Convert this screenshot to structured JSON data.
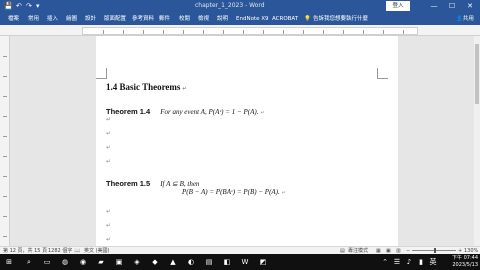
{
  "window": {
    "doc_title": "chapter_1_2023 - Word",
    "sign_in": "登入",
    "controls": [
      "—",
      "☐",
      "✕"
    ]
  },
  "ribbon": {
    "tabs": [
      "檔案",
      "常用",
      "插入",
      "繪圖",
      "設計",
      "版面配置",
      "參考資料",
      "郵件",
      "校閱",
      "檢視",
      "說明",
      "EndNote X9",
      "ACROBAT",
      "告訴我您想要執行什麼"
    ],
    "share": "共用"
  },
  "document": {
    "heading": "1.4 Basic Theorems",
    "theorem14_label": "Theorem 1.4",
    "theorem14_text": "For any event A, P(Aᶜ) = 1 − P(A).",
    "theorem15_label": "Theorem 1.5",
    "theorem15_text": "If A ⊆ B, then",
    "theorem15_eq": "P(B − A) = P(BAᶜ) = P(B) − P(A).",
    "para_mark": "↵"
  },
  "status": {
    "page": "第 12 頁，共 15 頁",
    "words": "1282 個字",
    "lang": "英文 (美國)",
    "focus": "專注模式",
    "zoom": "130%"
  },
  "taskbar": {
    "time": "下午 07:44",
    "date": "2023/5/13"
  }
}
